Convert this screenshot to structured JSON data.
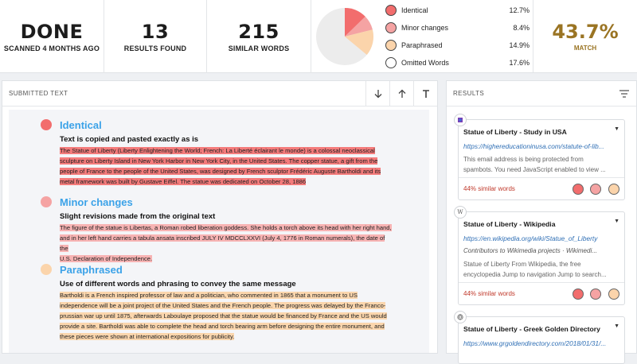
{
  "stats": {
    "status": "DONE",
    "scanned": "SCANNED 4 MONTHS AGO",
    "results_count": "13",
    "results_label": "RESULTS FOUND",
    "similar_count": "215",
    "similar_label": "SIMILAR WORDS",
    "match_value": "43.7%",
    "match_label": "MATCH"
  },
  "legend": [
    {
      "label": "Identical",
      "value": "12.7%",
      "color": "#f26d6d"
    },
    {
      "label": "Minor changes",
      "value": "8.4%",
      "color": "#f5a3a3"
    },
    {
      "label": "Paraphrased",
      "value": "14.9%",
      "color": "#fbd4ab"
    },
    {
      "label": "Omitted Words",
      "value": "17.6%",
      "color": "#ffffff"
    }
  ],
  "submitted": {
    "header": "SUBMITTED TEXT",
    "sections": [
      {
        "title": "Identical",
        "subtitle": "Text is copied and pasted exactly as is",
        "lines": [
          "The Statue of Liberty (Liberty Enlightening the World; French: La Liberté éclairant le monde) is a colossal neoclassical",
          "sculpture on Liberty Island in New York Harbor in New York City, in the United States. The copper statue, a gift from the",
          "people of France to the people of the United States, was designed by French sculptor Frédéric Auguste Bartholdi and its",
          "metal framework was built by Gustave Eiffel. The statue was dedicated on October 28, 1886"
        ]
      },
      {
        "title": "Minor changes",
        "subtitle": "Slight revisions made from the original text",
        "lines": [
          "The figure of the statue is Libertas, a Roman robed liberation goddess. She holds a torch above its head with her right hand,",
          "and in her left hand carries a tabula ansata inscribed JULY IV MDCCLXXVI (July 4, 1776 in Roman numerals), the date of the",
          "U.S. Declaration of Independence."
        ]
      },
      {
        "title": "Paraphrased",
        "subtitle": "Use of different words and phrasing to convey the same message",
        "lines": [
          "Bartholdi is a French inspired professor of law and a politician, who commented in 1865 that a monument to US",
          "independence will be a joint project of the United States and the French people. The progress was delayed by the Franco-",
          "prussian war up until 1875, afterwards Laboulaye proposed that the statue would be financed by France and the US would",
          "provide a site. Bartholdi was able to complete the head and torch bearing arm before designing the entire monument, and",
          "these pieces were shown at international expositions for publicity."
        ]
      }
    ]
  },
  "results": {
    "header": "RESULTS",
    "cards": [
      {
        "favicon": "",
        "title": "Statue of Liberty - Study in USA",
        "url": "https://highereducationinusa.com/statute-of-lib...",
        "meta": "",
        "desc": [
          "This email address is being protected from",
          "spambots. You need JavaScript enabled to view ..."
        ],
        "similar": "44% similar words"
      },
      {
        "favicon": "W",
        "title": "Statue of Liberty - Wikipedia",
        "url": "https://en.wikipedia.org/wiki/Statue_of_Liberty",
        "meta": "Contributors to Wikimedia projects · Wikimedi...",
        "desc": [
          "Statue of Liberty From Wikipedia, the free",
          "encyclopedia Jump to navigation Jump to search..."
        ],
        "similar": "44% similar words"
      },
      {
        "favicon": "",
        "title": "Statue of Liberty - Greek Golden Directory",
        "url": "https://www.grgoldendirectory.com/2018/01/31/...",
        "meta": "",
        "desc": [],
        "similar": ""
      }
    ]
  }
}
